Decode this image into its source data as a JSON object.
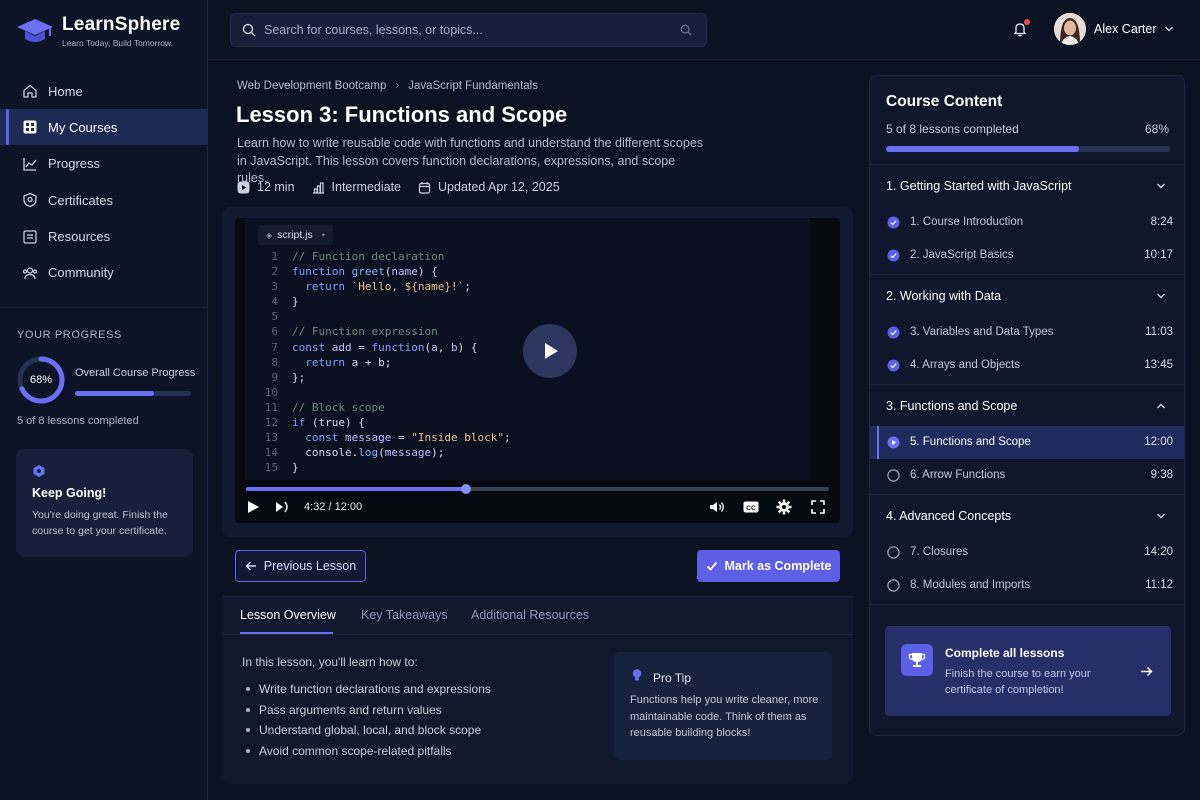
{
  "brand": {
    "name": "LearnSphere",
    "tagline": "Learn Today, Build Tomorrow."
  },
  "sidebar": {
    "items": [
      {
        "label": "Home",
        "icon": "home-icon"
      },
      {
        "label": "My Courses",
        "icon": "courses-icon",
        "active": true
      },
      {
        "label": "Progress",
        "icon": "chart-icon"
      },
      {
        "label": "Certificates",
        "icon": "certificate-icon"
      },
      {
        "label": "Resources",
        "icon": "folder-icon"
      },
      {
        "label": "Community",
        "icon": "community-icon"
      }
    ],
    "progress": {
      "heading": "YOUR PROGRESS",
      "percent_label": "68%",
      "percent": 68,
      "label": "Overall Course Progress",
      "count": "5 of 8 lessons completed"
    },
    "keep_going": {
      "title": "Keep Going!",
      "body": "You're doing great. Finish the course to get your certificate."
    }
  },
  "topbar": {
    "search_placeholder": "Search for courses, lessons, or topics...",
    "user_name": "Alex Carter",
    "has_notification": true
  },
  "breadcrumb": [
    "Web Development Bootcamp",
    "JavaScript Fundamentals"
  ],
  "lesson": {
    "title": "Lesson 3: Functions and Scope",
    "description": "Learn how to write reusable code with functions and understand the different scopes in JavaScript. This lesson covers function declarations, expressions, and scope rules.",
    "duration": "12 min",
    "level": "Intermediate",
    "updated": "Updated Apr 12, 2025"
  },
  "player": {
    "file_name": "script.js",
    "time": "4:32 / 12:00",
    "progress": 0.378,
    "code": [
      {
        "n": "1",
        "tokens": [
          [
            "c",
            "// Function declaration"
          ]
        ]
      },
      {
        "n": "2",
        "tokens": [
          [
            "k",
            "function "
          ],
          [
            "f",
            "greet"
          ],
          [
            "p",
            "("
          ],
          [
            "v",
            "name"
          ],
          [
            "p",
            ") {"
          ]
        ]
      },
      {
        "n": "3",
        "tokens": [
          [
            "p",
            "  "
          ],
          [
            "k",
            "return "
          ],
          [
            "s",
            "`Hello, ${name}!`"
          ],
          [
            "p",
            ";"
          ]
        ]
      },
      {
        "n": "4",
        "tokens": [
          [
            "p",
            "}"
          ]
        ]
      },
      {
        "n": "5",
        "tokens": []
      },
      {
        "n": "6",
        "tokens": [
          [
            "c",
            "// Function expression"
          ]
        ]
      },
      {
        "n": "7",
        "tokens": [
          [
            "k",
            "const "
          ],
          [
            "v",
            "add"
          ],
          [
            "p",
            " = "
          ],
          [
            "k",
            "function"
          ],
          [
            "p",
            "("
          ],
          [
            "v",
            "a"
          ],
          [
            "p",
            ", "
          ],
          [
            "v",
            "b"
          ],
          [
            "p",
            ") {"
          ]
        ]
      },
      {
        "n": "8",
        "tokens": [
          [
            "p",
            "  "
          ],
          [
            "k",
            "return "
          ],
          [
            "p",
            "a + b;"
          ]
        ]
      },
      {
        "n": "9",
        "tokens": [
          [
            "p",
            "};"
          ]
        ]
      },
      {
        "n": "10",
        "tokens": []
      },
      {
        "n": "11",
        "tokens": [
          [
            "c",
            "// Block scope"
          ]
        ]
      },
      {
        "n": "12",
        "tokens": [
          [
            "k",
            "if "
          ],
          [
            "p",
            "(true) {"
          ]
        ]
      },
      {
        "n": "13",
        "tokens": [
          [
            "p",
            "  "
          ],
          [
            "k",
            "const "
          ],
          [
            "v",
            "message"
          ],
          [
            "p",
            " = "
          ],
          [
            "s",
            "\"Inside block\""
          ],
          [
            "p",
            ";"
          ]
        ]
      },
      {
        "n": "14",
        "tokens": [
          [
            "p",
            "  console."
          ],
          [
            "f",
            "log"
          ],
          [
            "p",
            "("
          ],
          [
            "v",
            "message"
          ],
          [
            "p",
            ");"
          ]
        ]
      },
      {
        "n": "15",
        "tokens": [
          [
            "p",
            "}"
          ]
        ]
      }
    ]
  },
  "actions": {
    "previous": "Previous Lesson",
    "complete": "Mark as Complete"
  },
  "tabs": [
    "Lesson Overview",
    "Key Takeaways",
    "Additional Resources"
  ],
  "overview": {
    "intro": "In this lesson, you'll learn how to:",
    "bullets": [
      "Write function declarations and expressions",
      "Pass arguments and return values",
      "Understand global, local, and block scope",
      "Avoid common scope-related pitfalls"
    ],
    "tip_title": "Pro Tip",
    "tip_body": "Functions help you write cleaner, more maintainable code. Think of them as reusable building blocks!"
  },
  "course_content": {
    "title": "Course Content",
    "count": "5 of 8 lessons completed",
    "percent_label": "68%",
    "percent": 68,
    "sections": [
      {
        "title": "1. Getting Started with JavaScript",
        "expanded": true,
        "lessons": [
          {
            "name": "1. Course Introduction",
            "duration": "8:24",
            "status": "done"
          },
          {
            "name": "2. JavaScript Basics",
            "duration": "10:17",
            "status": "done"
          }
        ]
      },
      {
        "title": "2. Working with Data",
        "expanded": true,
        "lessons": [
          {
            "name": "3. Variables and Data Types",
            "duration": "11:03",
            "status": "done"
          },
          {
            "name": "4. Arrays and Objects",
            "duration": "13:45",
            "status": "done"
          }
        ]
      },
      {
        "title": "3. Functions and Scope",
        "expanded": true,
        "open": true,
        "lessons": [
          {
            "name": "5. Functions and Scope",
            "duration": "12:00",
            "status": "current"
          },
          {
            "name": "6. Arrow Functions",
            "duration": "9:38",
            "status": "todo"
          }
        ]
      },
      {
        "title": "4. Advanced Concepts",
        "expanded": true,
        "lessons": [
          {
            "name": "7. Closures",
            "duration": "14:20",
            "status": "todo"
          },
          {
            "name": "8. Modules and Imports",
            "duration": "11:12",
            "status": "todo"
          }
        ]
      }
    ],
    "cta": {
      "title": "Complete all lessons",
      "body": "Finish the course to earn your certificate of completion!"
    }
  },
  "colors": {
    "accent": "#5d5fe6",
    "background": "#0b1222",
    "panel": "#0e172c"
  }
}
